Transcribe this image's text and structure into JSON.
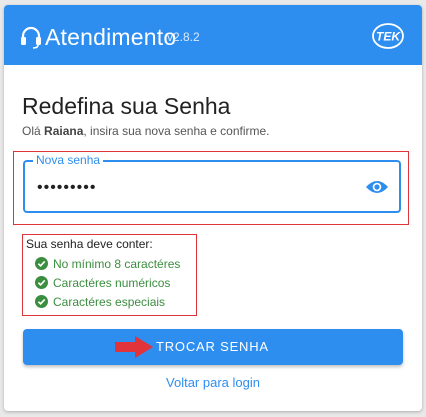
{
  "header": {
    "title": "Atendimento",
    "version": "v2.8.2",
    "logo_icon": "tek-logo-icon",
    "headset_icon": "headset-icon",
    "color": "#2e8ef0"
  },
  "form": {
    "heading": "Redefina sua Senha",
    "greeting": "Olá",
    "user_name": "Raiana",
    "instruction": ", insira sua nova senha e confirme.",
    "password_label": "Nova senha",
    "password_value": "•••••••••",
    "eye_icon": "eye-icon"
  },
  "requirements": {
    "title": "Sua senha deve conter:",
    "items": [
      {
        "label": "No mínimo 8 caractéres",
        "met": true
      },
      {
        "label": "Caractéres numéricos",
        "met": true
      },
      {
        "label": "Caractéres especiais",
        "met": true
      }
    ],
    "met_color": "#3b8e3f"
  },
  "actions": {
    "submit_label": "TROCAR SENHA",
    "login_link": "Voltar para login",
    "annotation_color": "#e0343a"
  }
}
